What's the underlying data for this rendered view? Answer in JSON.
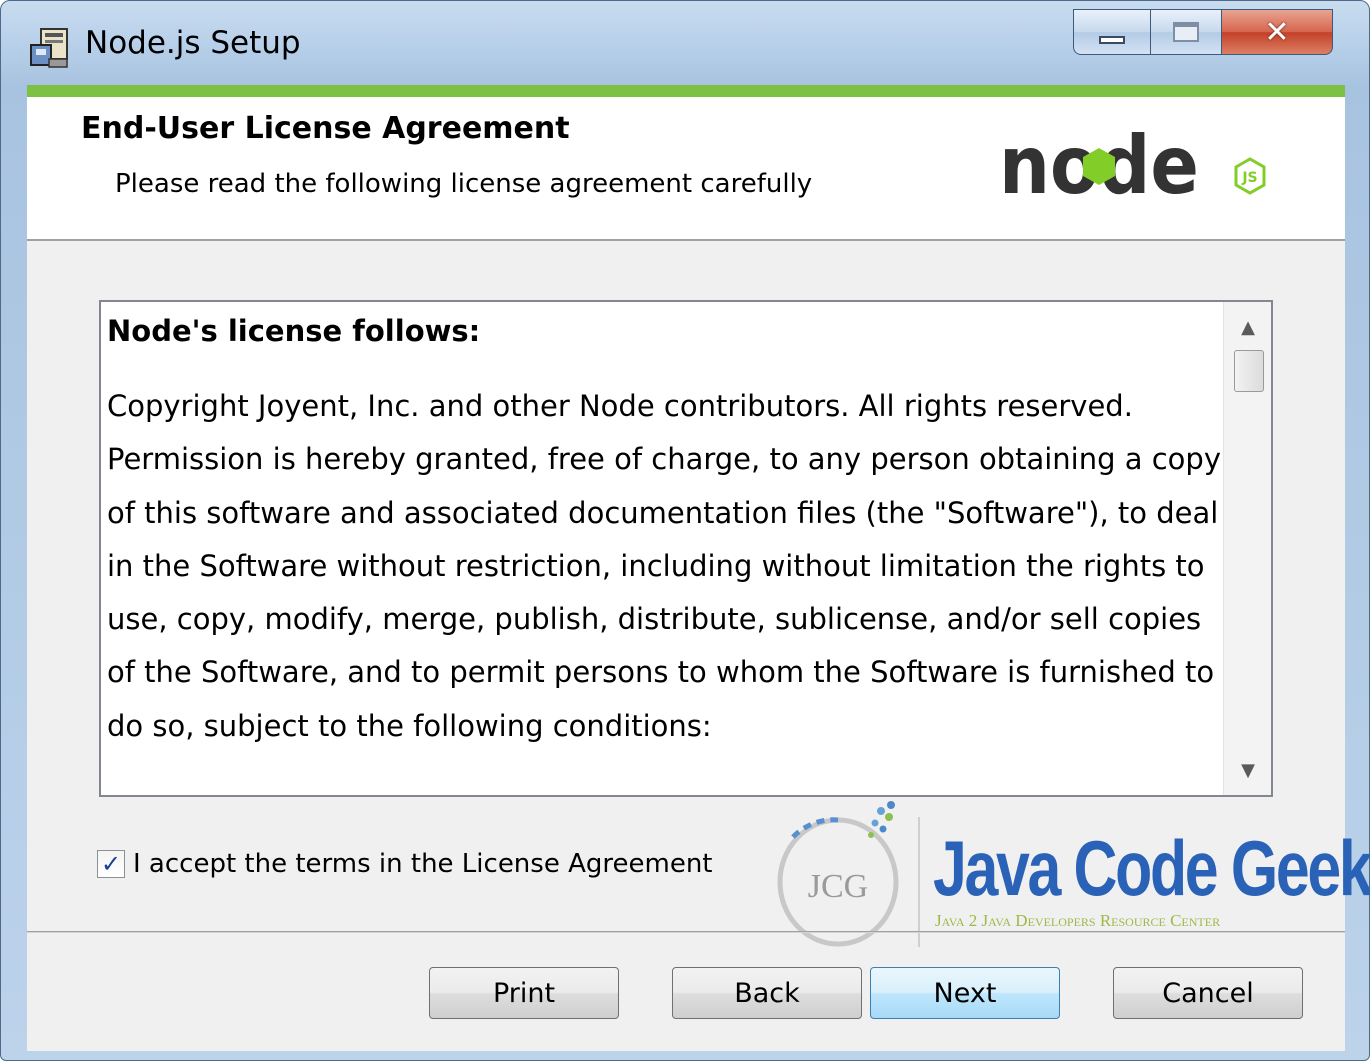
{
  "window": {
    "title": "Node.js Setup",
    "accent_color": "#7cc144"
  },
  "header": {
    "title": "End-User License Agreement",
    "subtitle": "Please read the following license agreement carefully",
    "logo_text": "node",
    "logo_badge": "JS"
  },
  "license": {
    "heading": "Node's license follows:",
    "paragraph": "Copyright Joyent, Inc. and other Node contributors. All rights reserved. Permission is hereby granted, free of charge, to any person obtaining a copy of this software and associated documentation files (the \"Software\"), to deal in the Software without restriction, including without limitation the rights to use, copy, modify, merge, publish, distribute, sublicense, and/or sell copies of the Software, and to permit persons to whom the Software is furnished to do so, subject to the following conditions:"
  },
  "accept": {
    "label": "I accept the terms in the License Agreement",
    "checked": true
  },
  "watermark": {
    "badge": "JCG",
    "name": "Java Code Geeks",
    "tagline": "Java 2 Java Developers Resource Center"
  },
  "buttons": {
    "print": "Print",
    "back": "Back",
    "next": "Next",
    "cancel": "Cancel"
  }
}
